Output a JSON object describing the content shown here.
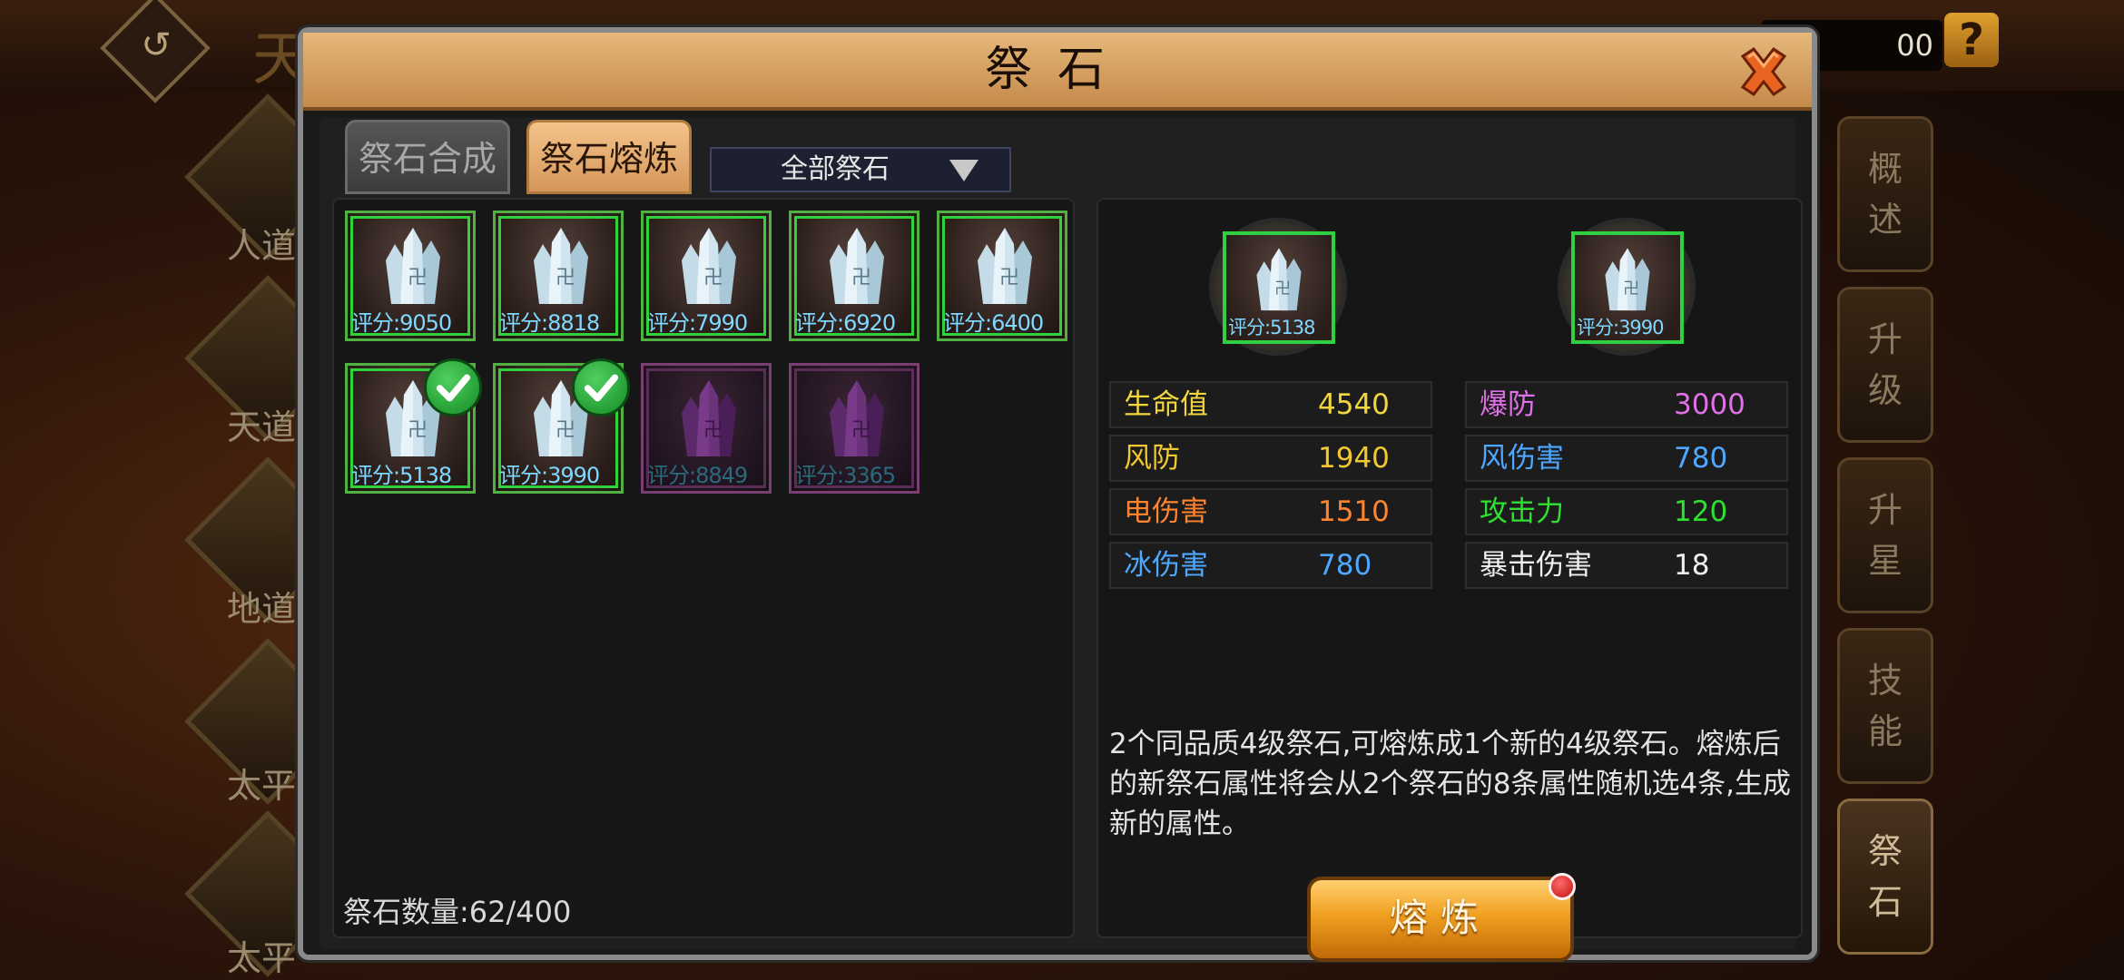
{
  "background": {
    "title_fragment": "天",
    "currency_fragment": "00",
    "help_label": "?",
    "left_labels": [
      "人道",
      "天道",
      "地道",
      "太平",
      "太平"
    ],
    "side_tabs": [
      "概述",
      "升级",
      "升星",
      "技能",
      "祭石"
    ]
  },
  "dialog": {
    "title": "祭石",
    "tabs": [
      "祭石合成",
      "祭石熔炼"
    ],
    "active_tab": "祭石熔炼",
    "filter": {
      "selected": "全部祭石"
    },
    "inventory": {
      "items": [
        {
          "score": "评分:9050",
          "quality": "green",
          "selected": false
        },
        {
          "score": "评分:8818",
          "quality": "green",
          "selected": false
        },
        {
          "score": "评分:7990",
          "quality": "green",
          "selected": false
        },
        {
          "score": "评分:6920",
          "quality": "green",
          "selected": false
        },
        {
          "score": "评分:6400",
          "quality": "green",
          "selected": false
        },
        {
          "score": "评分:5138",
          "quality": "green",
          "selected": true
        },
        {
          "score": "评分:3990",
          "quality": "green",
          "selected": true
        },
        {
          "score": "评分:8849",
          "quality": "purple",
          "selected": false
        },
        {
          "score": "评分:3365",
          "quality": "purple",
          "selected": false
        }
      ],
      "count_text": "祭石数量:62/400"
    },
    "selected": [
      {
        "score": "评分:5138"
      },
      {
        "score": "评分:3990"
      }
    ],
    "stats": [
      {
        "label": "生命值",
        "value": "4540",
        "label_color": "#f2d640",
        "value_color": "#f2d640"
      },
      {
        "label": "爆防",
        "value": "3000",
        "label_color": "#e070e8",
        "value_color": "#e070e8"
      },
      {
        "label": "风防",
        "value": "1940",
        "label_color": "#f2c830",
        "value_color": "#f2c830"
      },
      {
        "label": "风伤害",
        "value": "780",
        "label_color": "#4ea8ff",
        "value_color": "#4ea8ff"
      },
      {
        "label": "电伤害",
        "value": "1510",
        "label_color": "#ff8430",
        "value_color": "#ff8430"
      },
      {
        "label": "攻击力",
        "value": "120",
        "label_color": "#30e030",
        "value_color": "#30e030"
      },
      {
        "label": "冰伤害",
        "value": "780",
        "label_color": "#4ea8ff",
        "value_color": "#4ea8ff"
      },
      {
        "label": "暴击伤害",
        "value": "18",
        "label_color": "#f0f0f0",
        "value_color": "#f0f0f0"
      }
    ],
    "description": "2个同品质4级祭石,可熔炼成1个新的4级祭石。熔炼后的新祭石属性将会从2个祭石的8条属性随机选4条,生成新的属性。",
    "smelt_button": "熔炼"
  }
}
